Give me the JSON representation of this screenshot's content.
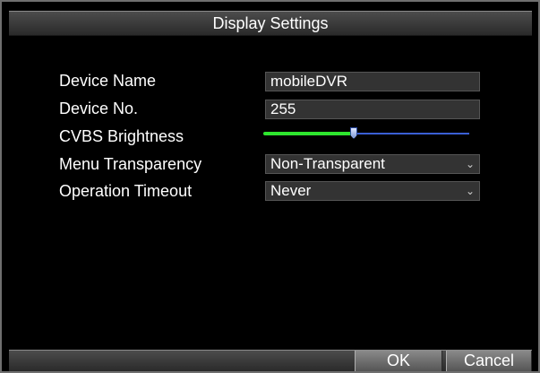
{
  "window": {
    "title": "Display Settings"
  },
  "form": {
    "device_name": {
      "label": "Device Name",
      "value": "mobileDVR"
    },
    "device_no": {
      "label": "Device No.",
      "value": "255"
    },
    "cvbs_brightness": {
      "label": "CVBS Brightness",
      "value_fraction": 0.44
    },
    "menu_transparency": {
      "label": "Menu Transparency",
      "value": "Non-Transparent"
    },
    "operation_timeout": {
      "label": "Operation Timeout",
      "value": "Never"
    }
  },
  "footer": {
    "ok_label": "OK",
    "cancel_label": "Cancel"
  },
  "colors": {
    "background": "#000000",
    "bar": "#3a3a3a",
    "field_bg": "#333333",
    "slider_fill": "#2ee62e",
    "slider_rest": "#3a5fd4",
    "text": "#ffffff"
  },
  "icons": {
    "dropdown": "chevron-down-icon"
  }
}
